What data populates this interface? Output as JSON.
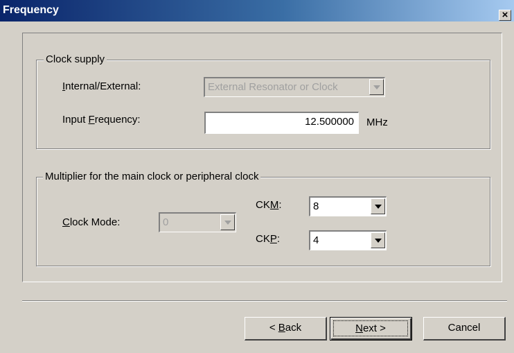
{
  "window": {
    "title": "Frequency",
    "close_label": "×"
  },
  "clock_supply": {
    "legend": "Clock supply",
    "internal_external": {
      "label_pre": "",
      "label_u": "I",
      "label_post": "nternal/External:",
      "value": "External Resonator or Clock"
    },
    "input_frequency": {
      "label_pre": "Input ",
      "label_u": "F",
      "label_post": "requency:",
      "value": "12.500000",
      "unit": "MHz"
    }
  },
  "multiplier": {
    "legend": "Multiplier for the main clock or peripheral clock",
    "clock_mode": {
      "label_pre": "",
      "label_u": "C",
      "label_post": "lock Mode:",
      "value": "0"
    },
    "ckm": {
      "label_pre": "CK",
      "label_u": "M",
      "label_post": ":",
      "value": "8"
    },
    "ckp": {
      "label_pre": "CK",
      "label_u": "P",
      "label_post": ":",
      "value": "4"
    }
  },
  "buttons": {
    "back": {
      "pre": "< ",
      "u": "B",
      "post": "ack"
    },
    "next": {
      "pre": "",
      "u": "N",
      "post": "ext >"
    },
    "cancel": {
      "label": "Cancel"
    }
  }
}
